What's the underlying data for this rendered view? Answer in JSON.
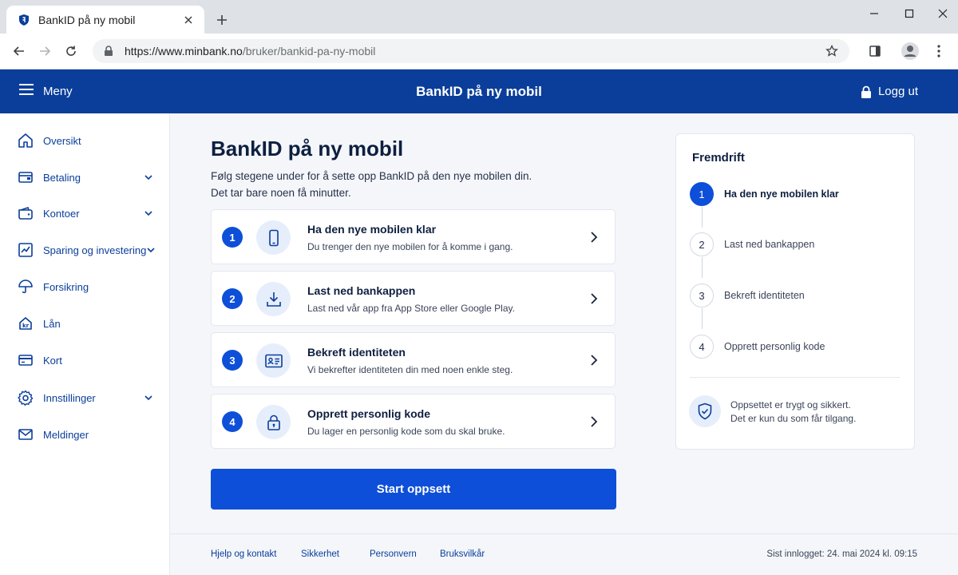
{
  "browser": {
    "tab_title": "BankID på ny mobil",
    "url_host": "https://www.minbank.no",
    "url_path": "/bruker/bankid-pa-ny-mobil"
  },
  "header": {
    "menu_label": "Meny",
    "title": "BankID på ny mobil",
    "logout_label": "Logg ut"
  },
  "sidebar": {
    "items": [
      {
        "label": "Oversikt",
        "icon": "home-icon",
        "expandable": false
      },
      {
        "label": "Betaling",
        "icon": "wallet-icon",
        "expandable": true
      },
      {
        "label": "Kontoer",
        "icon": "purse-icon",
        "expandable": true
      },
      {
        "label": "Sparing og investering",
        "icon": "chart-icon",
        "expandable": true
      },
      {
        "label": "Forsikring",
        "icon": "umbrella-icon",
        "expandable": false
      },
      {
        "label": "Lån",
        "icon": "house-loan-icon",
        "expandable": false
      },
      {
        "label": "Kort",
        "icon": "card-icon",
        "expandable": false
      },
      {
        "label": "Innstillinger",
        "icon": "gear-icon",
        "expandable": true
      },
      {
        "label": "Meldinger",
        "icon": "mail-icon",
        "expandable": false
      }
    ]
  },
  "main": {
    "title": "BankID på ny mobil",
    "subtitle_line1": "Følg stegene under for å sette opp BankID på den nye mobilen din.",
    "subtitle_line2": "Det tar bare noen få minutter.",
    "steps": [
      {
        "number": "1",
        "title": "Ha den nye mobilen klar",
        "description": "Du trenger den nye mobilen for å komme i gang.",
        "icon": "phone-icon"
      },
      {
        "number": "2",
        "title": "Last ned bankappen",
        "description": "Last ned vår app fra App Store eller Google Play.",
        "icon": "download-icon"
      },
      {
        "number": "3",
        "title": "Bekreft identiteten",
        "description": "Vi bekrefter identiteten din med noen enkle steg.",
        "icon": "id-card-icon"
      },
      {
        "number": "4",
        "title": "Opprett personlig kode",
        "description": "Du lager en personlig kode som du skal bruke.",
        "icon": "lock-icon"
      }
    ],
    "start_button": "Start oppsett"
  },
  "progress": {
    "title": "Fremdrift",
    "steps": [
      {
        "number": "1",
        "label": "Ha den nye mobilen klar",
        "active": true
      },
      {
        "number": "2",
        "label": "Last ned bankappen",
        "active": false
      },
      {
        "number": "3",
        "label": "Bekreft identiteten",
        "active": false
      },
      {
        "number": "4",
        "label": "Opprett personlig kode",
        "active": false
      }
    ],
    "secure_line1": "Oppsettet er trygt og sikkert.",
    "secure_line2": "Det er kun du som får tilgang."
  },
  "footer": {
    "links": [
      "Hjelp og kontakt",
      "Sikkerhet",
      "Personvern",
      "Bruksvilkår"
    ],
    "last_login": "Sist innlogget: 24. mai 2024 kl. 09:15"
  },
  "colors": {
    "brand": "#0a3e9a",
    "accent": "#0d4fd8",
    "background": "#f4f6fa"
  }
}
